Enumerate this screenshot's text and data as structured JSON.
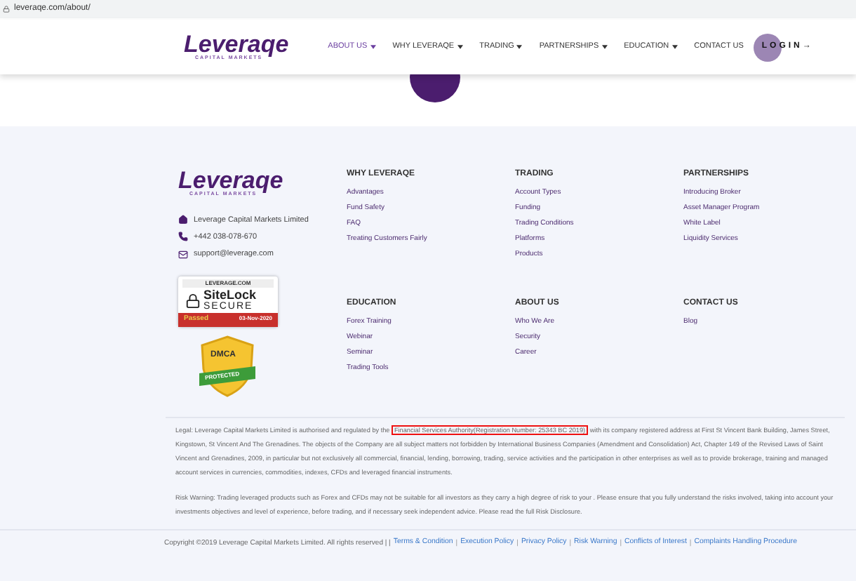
{
  "address_bar": {
    "url": "leveraqe.com/about/"
  },
  "header": {
    "logo": {
      "name": "Leveraqe",
      "tagline": "CAPITAL MARKETS"
    },
    "nav": [
      {
        "label": "ABOUT US",
        "dropdown": true,
        "selected": true
      },
      {
        "label": "WHY LEVERAQE",
        "dropdown": true,
        "selected": false
      },
      {
        "label": "TRADING",
        "dropdown": true,
        "selected": false
      },
      {
        "label": "PARTNERSHIPS",
        "dropdown": true,
        "selected": false
      },
      {
        "label": "EDUCATION",
        "dropdown": true,
        "selected": false
      },
      {
        "label": "CONTACT US",
        "dropdown": false,
        "selected": false
      }
    ],
    "login": "LOGIN→"
  },
  "footer": {
    "logo": {
      "name": "Leveraqe",
      "tagline": "CAPITAL MARKETS"
    },
    "contacts": [
      {
        "kind": "address",
        "text": "Leverage Capital Markets Limited"
      },
      {
        "kind": "phone",
        "text": "+442 038-078-670"
      },
      {
        "kind": "email",
        "text": "support@leverage.com"
      }
    ],
    "sitelock": {
      "domain": "LEVERAGE.COM",
      "brand": "SiteLock",
      "secure": "SECURE",
      "status": "Passed",
      "date": "03-Nov-2020"
    },
    "dmca": {
      "brand": "DMCA",
      "status": "PROTECTED"
    },
    "columns": [
      {
        "heading": "WHY LEVERAQE",
        "links": [
          "Advantages",
          "Fund Safety",
          "FAQ",
          "Treating Customers Fairly"
        ]
      },
      {
        "heading": "TRADING",
        "links": [
          "Account Types",
          "Funding",
          "Trading Conditions",
          "Platforms",
          "Products"
        ]
      },
      {
        "heading": "PARTNERSHIPS",
        "links": [
          "Introducing Broker",
          "Asset Manager Program",
          "White Label",
          "Liquidity Services"
        ]
      },
      {
        "heading": "EDUCATION",
        "links": [
          "Forex Training",
          "Webinar",
          "Seminar",
          "Trading Tools"
        ]
      },
      {
        "heading": "ABOUT US",
        "links": [
          "Who We Are",
          "Security",
          "Career"
        ]
      },
      {
        "heading": "CONTACT US",
        "links": [
          "Blog"
        ]
      }
    ],
    "legal": {
      "before": "Legal: Leverage Capital Markets Limited is authorised and regulated by the ",
      "highlighted": "Financial Services Authority(Registration Number: 25343 BC 2019)",
      "after": " with its company registered address at First St Vincent Bank Building, James Street, Kingstown, St Vincent And The Grenadines. The objects of the Company are all subject matters not forbidden by International Business Companies (Amendment and Consolidation) Act, Chapter 149 of the Revised Laws of Saint Vincent and Grenadines, 2009, in particular but not exclusively all commercial, financial, lending, borrowing, trading, service activities and the participation in other enterprises as well as to provide brokerage, training and managed account services in currencies, commodities, indexes, CFDs and leveraged financial instruments."
    },
    "risk_warning": "Risk Warning: Trading leveraged products such as Forex and CFDs may not be suitable for all investors as they carry a high degree of risk to your . Please ensure that you fully understand the risks involved, taking into account your investments objectives and level of experience, before trading, and if necessary seek independent advice. Please read the full Risk Disclosure.",
    "copyright": "Copyright ©2019 Leverage Capital Markets Limited. All rights reserved | |",
    "link_separator": "|",
    "bottom_links": [
      "Terms & Condition",
      "Execution Policy",
      "Privacy Policy",
      "Risk Warning",
      "Conflicts of Interest",
      "Complaints Handling Procedure"
    ]
  }
}
